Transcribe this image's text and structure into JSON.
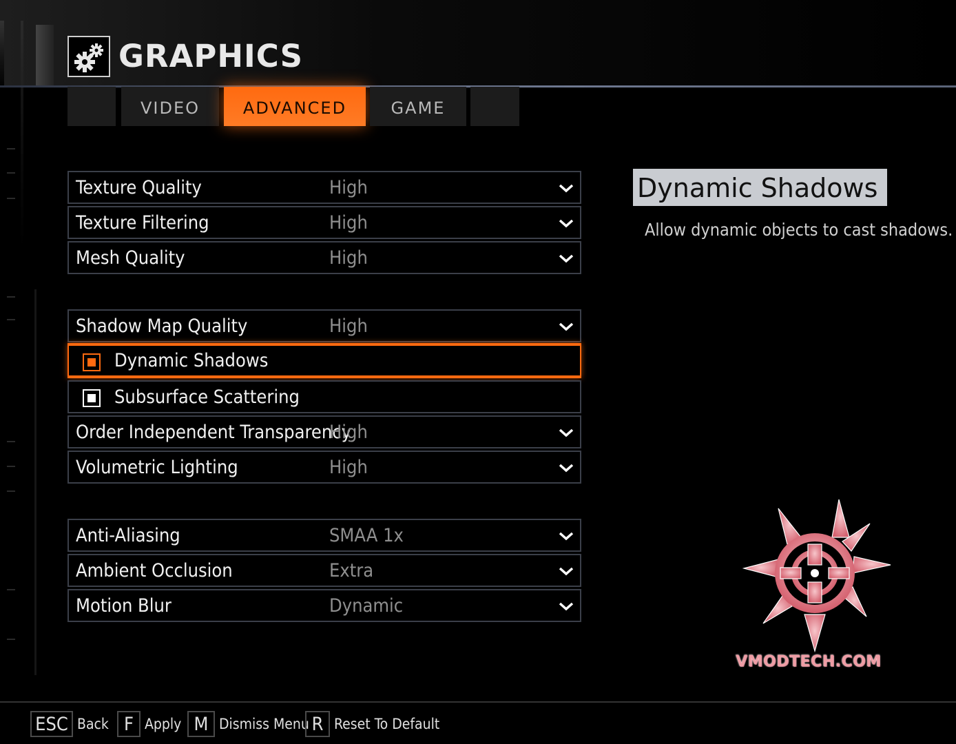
{
  "header": {
    "title": "GRAPHICS",
    "icon": "gears-icon"
  },
  "tabs": [
    {
      "label": ""
    },
    {
      "label": "VIDEO"
    },
    {
      "label": "ADVANCED",
      "active": true
    },
    {
      "label": "GAME"
    },
    {
      "label": ""
    }
  ],
  "settings": [
    {
      "label": "Texture Quality",
      "value": "High",
      "type": "dropdown"
    },
    {
      "label": "Texture Filtering",
      "value": "High",
      "type": "dropdown"
    },
    {
      "label": "Mesh Quality",
      "value": "High",
      "type": "dropdown"
    },
    {
      "label": "Shadow Map Quality",
      "value": "High",
      "type": "dropdown"
    },
    {
      "label": "Dynamic Shadows",
      "checked": true,
      "type": "checkbox",
      "selected": true
    },
    {
      "label": "Subsurface Scattering",
      "checked": true,
      "type": "checkbox"
    },
    {
      "label": "Order Independent Transparency",
      "value": "High",
      "type": "dropdown"
    },
    {
      "label": "Volumetric Lighting",
      "value": "High",
      "type": "dropdown"
    },
    {
      "label": "Anti-Aliasing",
      "value": "SMAA 1x",
      "type": "dropdown"
    },
    {
      "label": "Ambient Occlusion",
      "value": "Extra",
      "type": "dropdown"
    },
    {
      "label": "Motion Blur",
      "value": "Dynamic",
      "type": "dropdown"
    }
  ],
  "detail": {
    "title": "Dynamic Shadows",
    "description": "Allow dynamic objects to cast shadows."
  },
  "watermark": {
    "text": "VMODTECH.COM"
  },
  "footer": [
    {
      "key": "ESC",
      "label": "Back"
    },
    {
      "key": "F",
      "label": "Apply"
    },
    {
      "key": "M",
      "label": "Dismiss Menu"
    },
    {
      "key": "R",
      "label": "Reset To Default"
    }
  ],
  "colors": {
    "accent": "#ff6a10",
    "row_border": "#3b3f49",
    "value_text": "#8f8f8f"
  }
}
